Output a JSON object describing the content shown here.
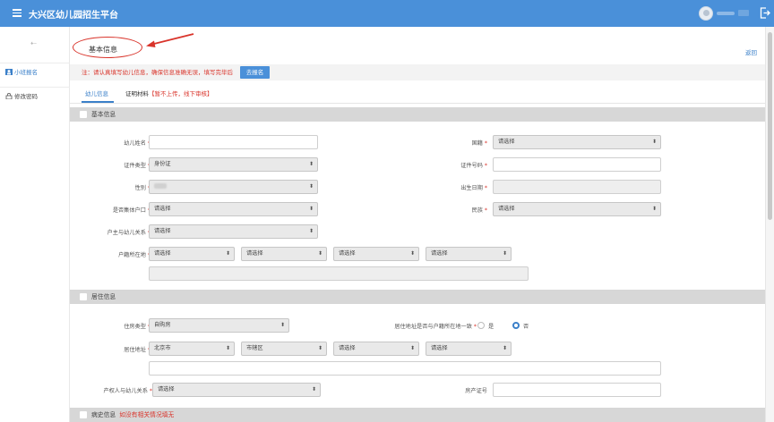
{
  "header": {
    "title": "大兴区幼儿园招生平台"
  },
  "sidebar": {
    "items": [
      {
        "label": "小班报名",
        "active": true
      },
      {
        "label": "修改密码",
        "active": false
      }
    ]
  },
  "page": {
    "title": "基本信息",
    "back": "返回",
    "notice": "注：请认真填写幼儿信息，确保信息准确无误，填写完毕后",
    "notice_button": "去报名"
  },
  "tabs": [
    {
      "label": "幼儿信息",
      "active": true
    },
    {
      "label": "证明材料",
      "hint": "【暂不上传，线下审核】"
    }
  ],
  "sections": {
    "basic": "基本信息",
    "residence": "居住信息",
    "medical": "病史信息",
    "medical_hint": "如没有相关情况填无"
  },
  "basic_fields": {
    "child_name": {
      "label": "幼儿姓名",
      "value": ""
    },
    "nationality": {
      "label": "国籍",
      "value": "请选择"
    },
    "id_type": {
      "label": "证件类型",
      "value": "身份证"
    },
    "id_number": {
      "label": "证件号码",
      "value": ""
    },
    "gender": {
      "label": "性别"
    },
    "birth_date": {
      "label": "出生日期",
      "value": ""
    },
    "collective_hukou": {
      "label": "是否集体户口",
      "value": "请选择"
    },
    "ethnicity": {
      "label": "民族",
      "value": "请选择"
    },
    "householder_relation": {
      "label": "户主与幼儿关系",
      "value": "请选择"
    },
    "hukou_location": {
      "label": "户籍所在地",
      "values": [
        "请选择",
        "请选择",
        "请选择",
        "请选择"
      ]
    }
  },
  "residence_fields": {
    "housing_type": {
      "label": "住房类型",
      "value": "自购房"
    },
    "same_as_hukou": {
      "label": "居住地址是否与户籍所在地一致",
      "options": [
        "是",
        "否"
      ],
      "selected": "否"
    },
    "address": {
      "label": "居住地址",
      "values": [
        "北京市",
        "市辖区",
        "请选择",
        "请选择"
      ]
    },
    "owner_relation": {
      "label": "产权人与幼儿关系",
      "value": "请选择"
    },
    "property_cert": {
      "label": "房产证号",
      "value": ""
    }
  },
  "colors": {
    "primary": "#4a90d9",
    "accent_red": "#d9342b",
    "link": "#3b80c9"
  }
}
